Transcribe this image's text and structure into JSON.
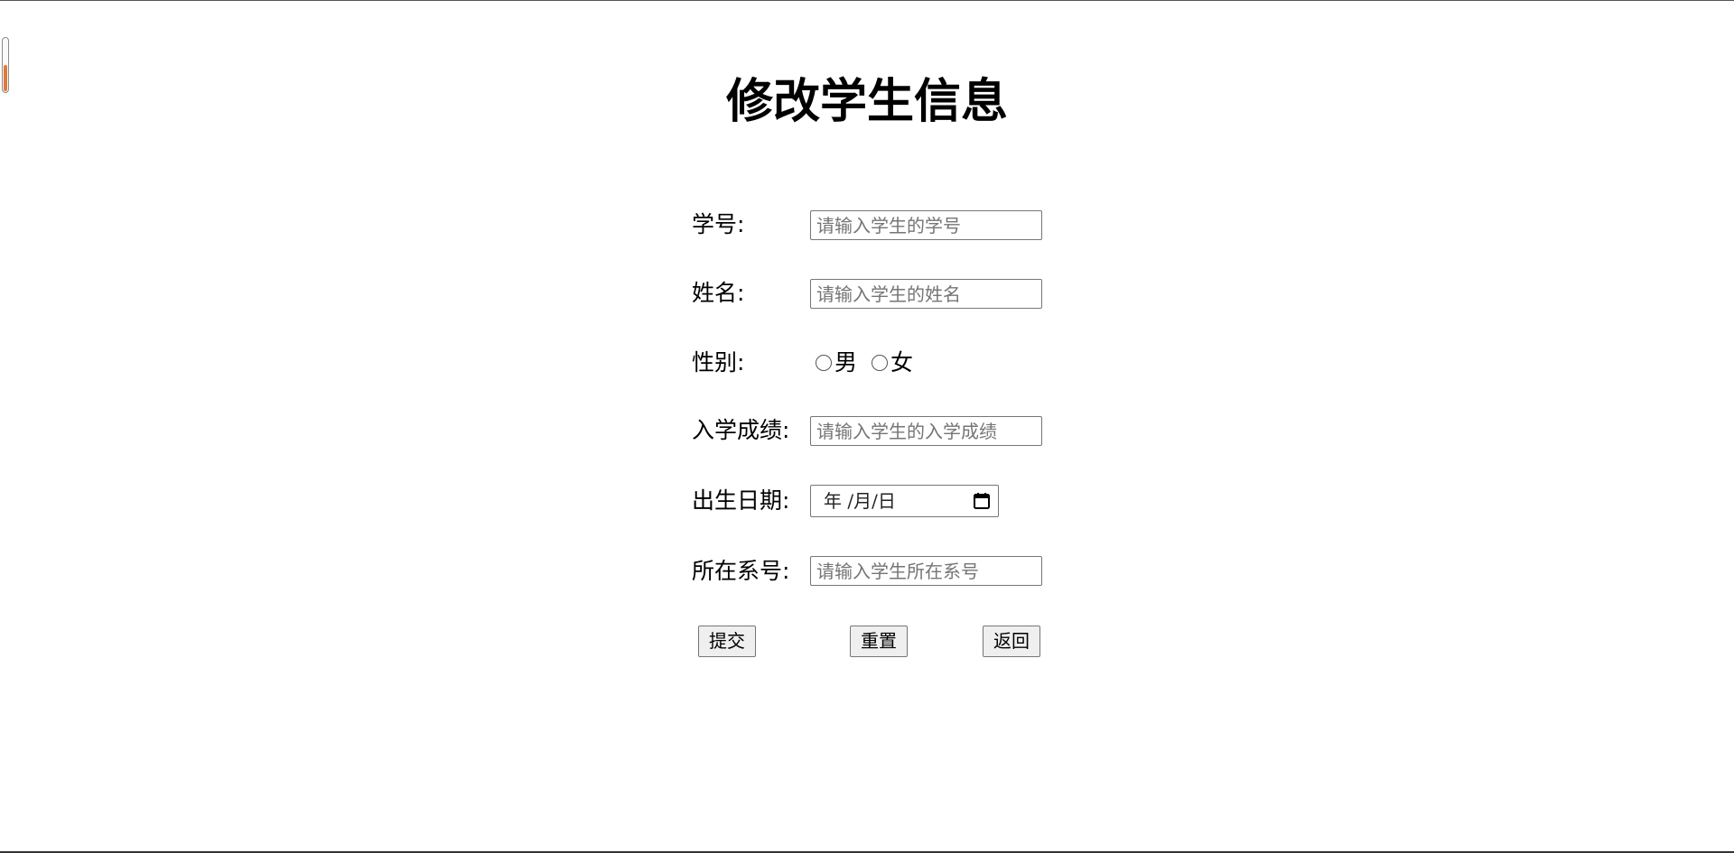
{
  "form": {
    "title": "修改学生信息",
    "fields": {
      "student_id": {
        "label": "学号:",
        "placeholder": "请输入学生的学号",
        "value": ""
      },
      "name": {
        "label": "姓名:",
        "placeholder": "请输入学生的姓名",
        "value": ""
      },
      "gender": {
        "label": "性别:",
        "options": [
          "男",
          "女"
        ]
      },
      "entrance_score": {
        "label": "入学成绩:",
        "placeholder": "请输入学生的入学成绩",
        "value": ""
      },
      "birth_date": {
        "label": "出生日期:",
        "display": "年 /月/日"
      },
      "department_id": {
        "label": "所在系号:",
        "placeholder": "请输入学生所在系号",
        "value": ""
      }
    },
    "buttons": {
      "submit": "提交",
      "reset": "重置",
      "back": "返回"
    }
  },
  "icons": {
    "calendar": "calendar-icon",
    "radio": "radio-circle-icon"
  },
  "left_gauge": {
    "fill_fraction": 0.52,
    "color": "#e07b39"
  }
}
